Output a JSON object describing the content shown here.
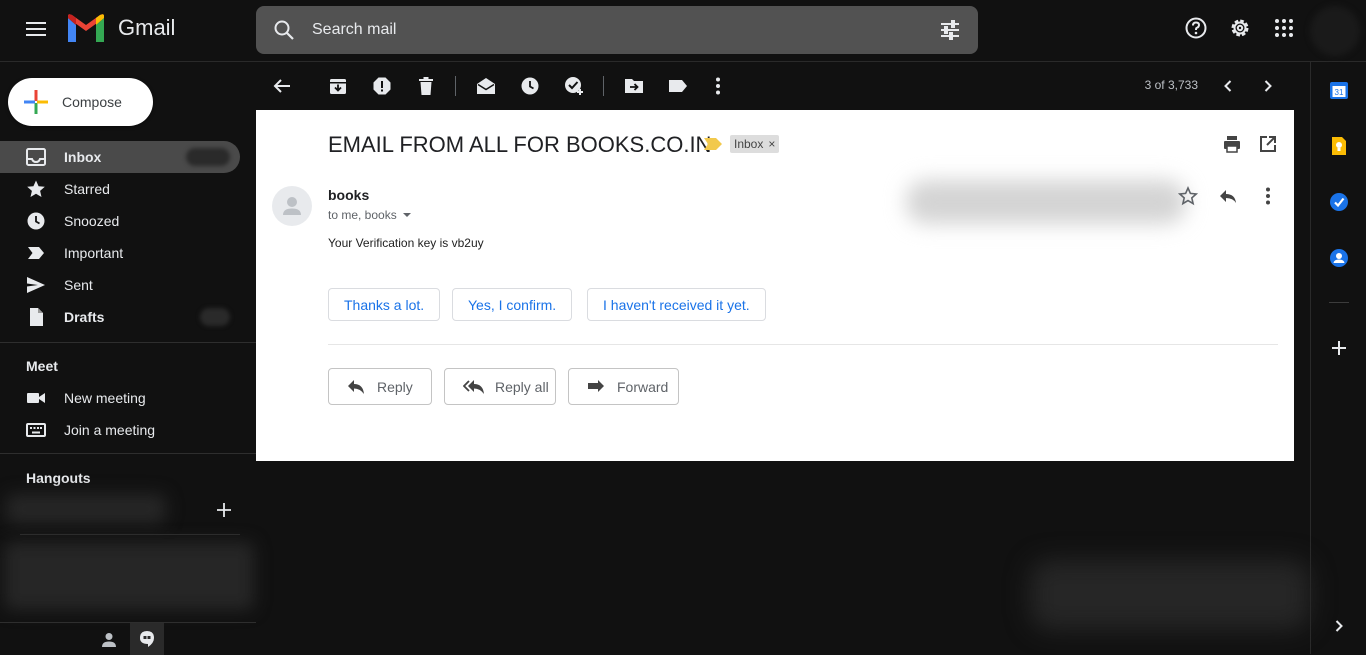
{
  "app": {
    "name": "Gmail",
    "search_placeholder": "Search mail"
  },
  "sidebar": {
    "compose_label": "Compose",
    "items": [
      {
        "label": "Inbox",
        "icon": "inbox-icon"
      },
      {
        "label": "Starred",
        "icon": "star-icon"
      },
      {
        "label": "Snoozed",
        "icon": "clock-icon"
      },
      {
        "label": "Important",
        "icon": "important-icon"
      },
      {
        "label": "Sent",
        "icon": "send-icon"
      },
      {
        "label": "Drafts",
        "icon": "draft-icon"
      }
    ],
    "meet": {
      "title": "Meet",
      "items": [
        {
          "label": "New meeting",
          "icon": "video-icon"
        },
        {
          "label": "Join a meeting",
          "icon": "keyboard-icon"
        }
      ]
    },
    "hangouts_title": "Hangouts"
  },
  "toolbar": {
    "pager": "3 of 3,733"
  },
  "email": {
    "subject": "EMAIL FROM ALL FOR BOOKS.CO.IN",
    "label": "Inbox",
    "label_close": "×",
    "sender": "books",
    "recipients": "to me, books",
    "body": "Your Verification key is vb2uy",
    "smart_replies": [
      "Thanks a lot.",
      "Yes, I confirm.",
      "I haven't received it yet."
    ],
    "actions": {
      "reply": "Reply",
      "reply_all": "Reply all",
      "forward": "Forward"
    }
  },
  "colors": {
    "background": "#111111",
    "active_nav": "#4a4a4a",
    "search_bg": "#525252",
    "link_blue": "#1a73e8",
    "important_marker": "#f2c94c"
  }
}
